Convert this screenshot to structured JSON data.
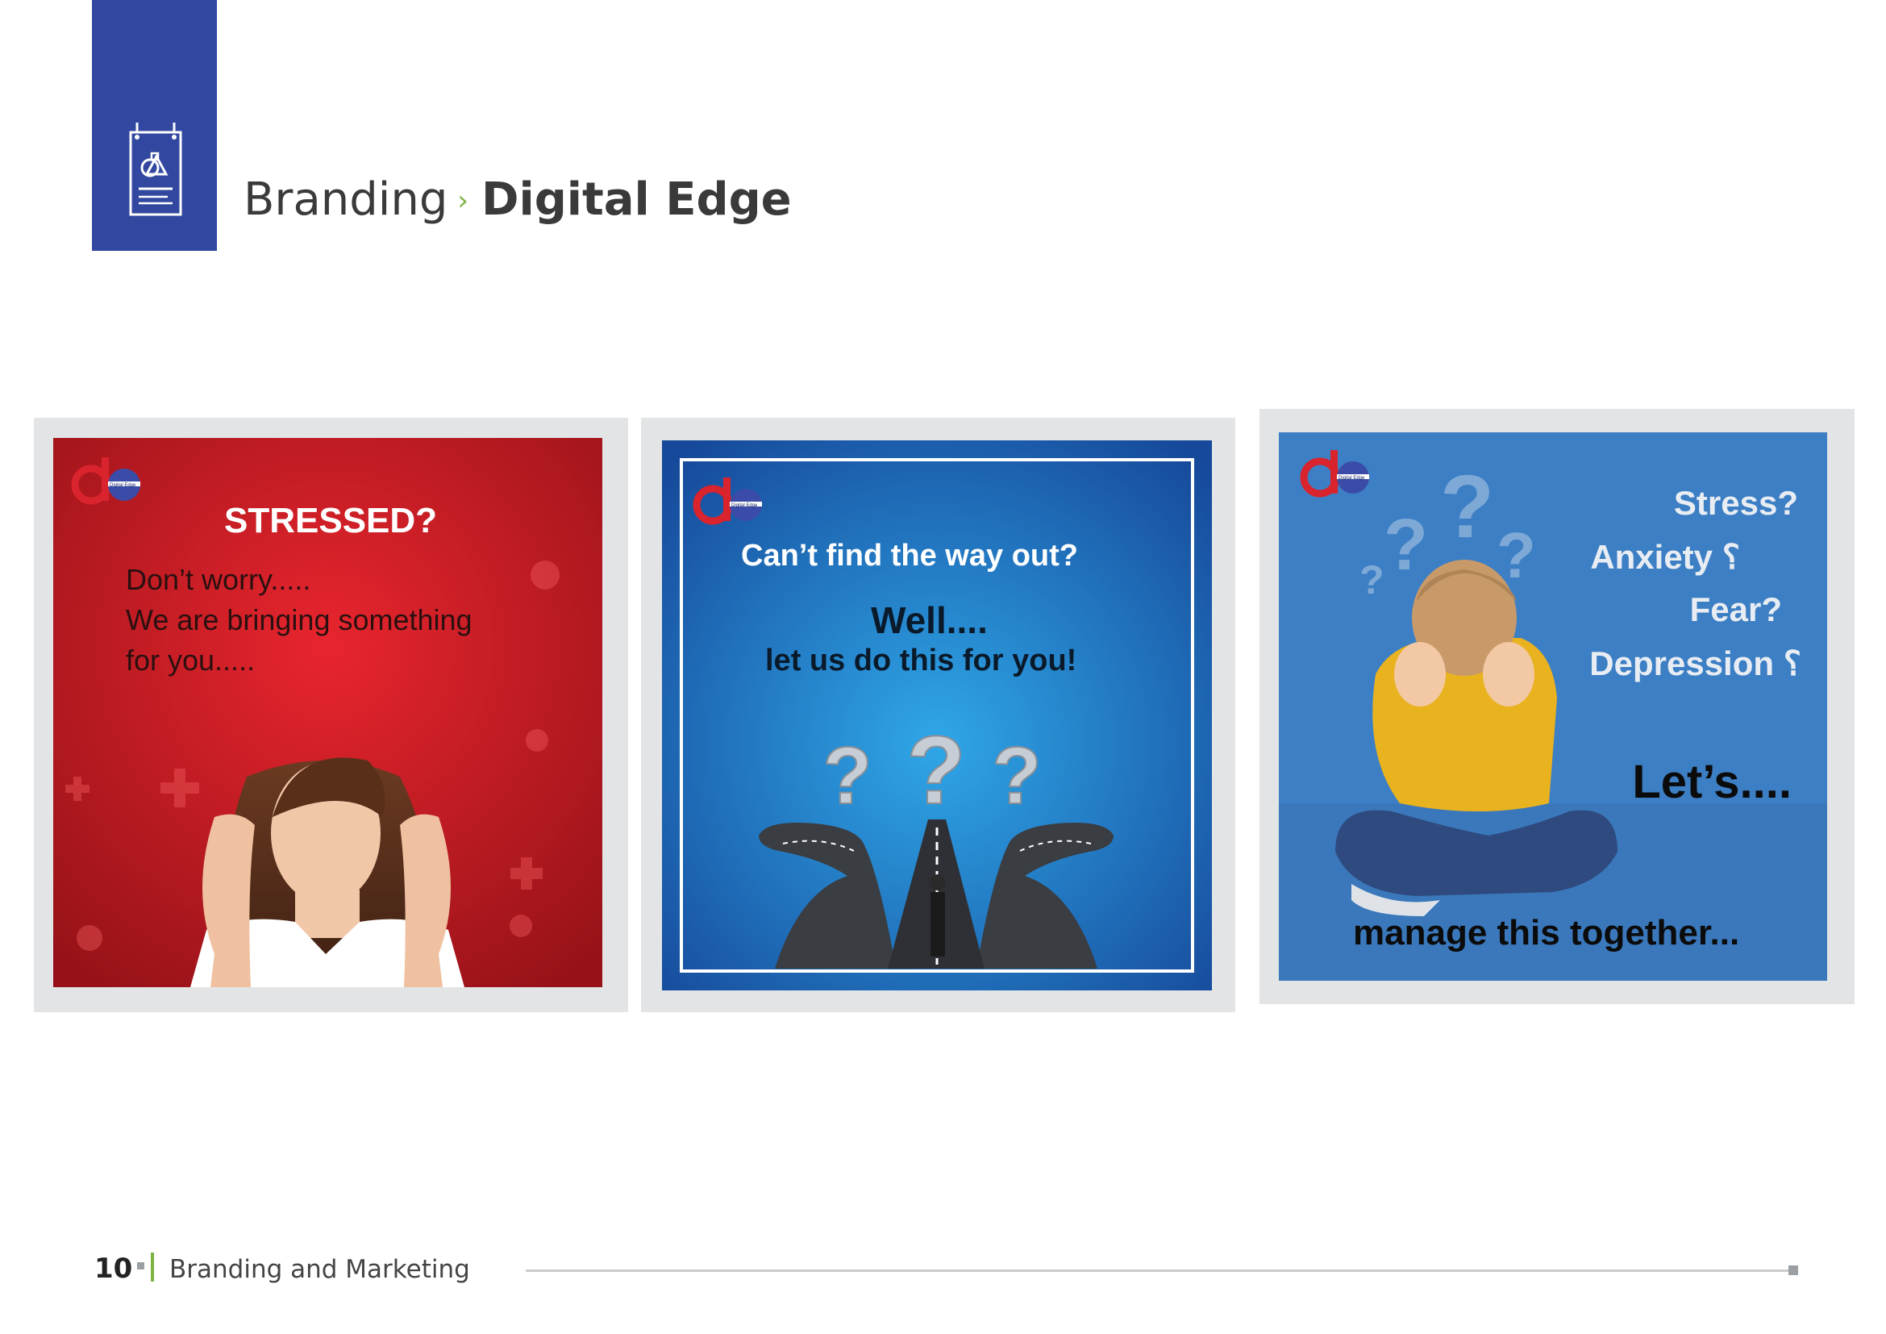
{
  "header": {
    "section": "Branding",
    "separator": "›",
    "title": "Digital Edge",
    "icon": "design-brief-icon"
  },
  "posters": [
    {
      "logo_text": "Digital Edge",
      "headline": "STRESSED?",
      "lines": [
        "Don’t worry.....",
        "We are bringing something",
        "for you....."
      ]
    },
    {
      "logo_text": "Digital Edge",
      "headline": "Can’t find the way out?",
      "line2": "Well....",
      "line3": "let us do this for you!"
    },
    {
      "logo_text": "Digital Edge",
      "words": [
        "Stress?",
        "Anxiety ؟",
        "Fear?",
        "Depression ؟"
      ],
      "lets": "Let’s....",
      "bottom": "manage this together..."
    }
  ],
  "footer": {
    "page_number": "10",
    "label": "Branding and Marketing"
  },
  "colors": {
    "brand_blue": "#3248a0",
    "accent_green": "#7cb342",
    "poster1_red": "#d61f2c",
    "poster2_blue": "#1d74c9",
    "poster3_blue": "#3d7fc4"
  }
}
